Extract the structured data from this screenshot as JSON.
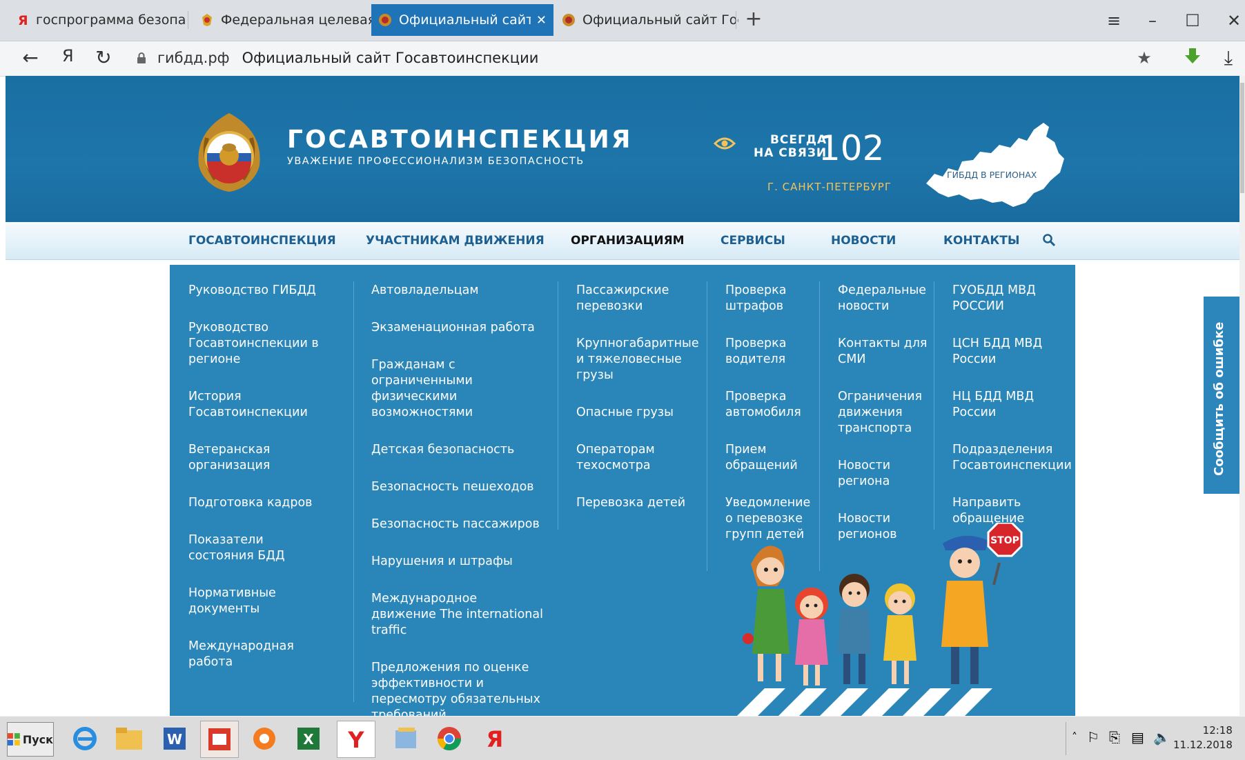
{
  "browser": {
    "tabs": [
      {
        "label": "госпрограмма безопасност",
        "icon": "yandex-icon",
        "active": false
      },
      {
        "label": "Федеральная целевая прог",
        "icon": "emblem-icon",
        "active": false
      },
      {
        "label": "Официальный сайт Госа",
        "icon": "gibdd-icon",
        "active": true
      },
      {
        "label": "Официальный сайт Госавт",
        "icon": "gibdd-icon",
        "active": false
      }
    ],
    "new_tab": "+",
    "address": {
      "domain": "гибдд.рф",
      "title": "Официальный сайт Госавтоинспекции"
    }
  },
  "site": {
    "brand_title": "ГОСАВТОИНСПЕКЦИЯ",
    "brand_subtitle": "УВАЖЕНИЕ ПРОФЕССИОНАЛИЗМ БЕЗОПАСНОСТЬ",
    "always_line1": "ВСЕГДА",
    "always_line2": "НА СВЯЗИ",
    "phone": "102",
    "city": "Г. САНКТ-ПЕТЕРБУРГ",
    "regions_label": "ГИБДД В РЕГИОНАХ",
    "nav": [
      "ГОСАВТОИНСПЕКЦИЯ",
      "УЧАСТНИКАМ ДВИЖЕНИЯ",
      "ОРГАНИЗАЦИЯМ",
      "СЕРВИСЫ",
      "НОВОСТИ",
      "КОНТАКТЫ"
    ],
    "menu": {
      "col1": [
        "Руководство ГИБДД",
        "Руководство Госавтоинспекции в регионе",
        "История Госавтоинспекции",
        "Ветеранская организация",
        "Подготовка кадров",
        "Показатели состояния БДД",
        "Нормативные документы",
        "Международная работа"
      ],
      "col2": [
        "Автовладельцам",
        "Экзаменационная работа",
        "Гражданам с ограниченными физическими возможностями",
        "Детская безопасность",
        "Безопасность пешеходов",
        "Безопасность пассажиров",
        "Нарушения и штрафы",
        "Международное движение The international traffic",
        "Предложения по оценке эффективности и пересмотру обязательных требований"
      ],
      "col3": [
        "Пассажирские перевозки",
        "Крупногабаритные и тяжеловесные грузы",
        "Опасные грузы",
        "Операторам техосмотра",
        "Перевозка детей"
      ],
      "col4": [
        "Проверка штрафов",
        "Проверка водителя",
        "Проверка автомобиля",
        "Прием обращений",
        "Уведомление о перевозке групп детей"
      ],
      "col5": [
        "Федеральные новости",
        "Контакты для СМИ",
        "Ограничения движения транспорта",
        "Новости региона",
        "Новости регионов"
      ],
      "col6": [
        "ГУОБДД МВД РОССИИ",
        "ЦСН БДД МВД России",
        "НЦ БДД МВД России",
        "Подразделения Госавтоинспекции",
        "Направить обращение"
      ]
    },
    "stop_sign": "STOP",
    "feedback": "Сообщить об ошибке"
  },
  "taskbar": {
    "start": "Пуск",
    "apps": [
      "ie-icon",
      "explorer-icon",
      "word-icon",
      "reader-icon",
      "avast-icon",
      "excel-icon",
      "yandex-browser-icon",
      "notes-icon",
      "chrome-icon",
      "yandex-icon"
    ],
    "time": "12:18",
    "date": "11.12.2018"
  }
}
